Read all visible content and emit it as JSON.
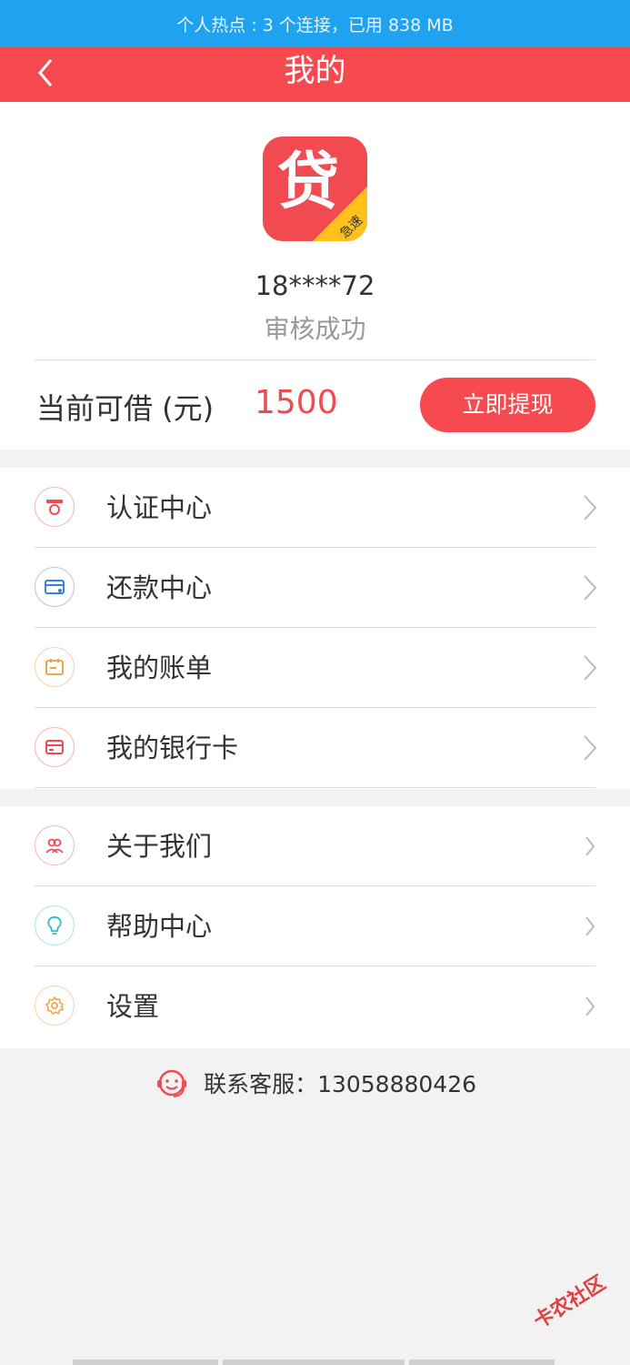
{
  "status_bar": {
    "text": "个人热点 : 3 个连接，已用 838 MB"
  },
  "header": {
    "title": "我的"
  },
  "profile": {
    "logo_char": "贷",
    "logo_badge": "急速",
    "phone": "18****72",
    "status": "审核成功",
    "borrow_label": "当前可借 (元)",
    "borrow_amount": "1500",
    "withdraw_button": "立即提现"
  },
  "menu_group_1": [
    {
      "label": "认证中心",
      "icon": "certification-icon",
      "color": "#f24a51"
    },
    {
      "label": "还款中心",
      "icon": "repayment-icon",
      "color": "#3b7fe0"
    },
    {
      "label": "我的账单",
      "icon": "bill-icon",
      "color": "#f5a24b"
    },
    {
      "label": "我的银行卡",
      "icon": "bank-card-icon",
      "color": "#f24a51"
    }
  ],
  "menu_group_2": [
    {
      "label": "关于我们",
      "icon": "about-us-icon",
      "color": "#f24a51"
    },
    {
      "label": "帮助中心",
      "icon": "help-icon",
      "color": "#2dbfbf"
    },
    {
      "label": "设置",
      "icon": "settings-icon",
      "color": "#f5a24b"
    }
  ],
  "contact": {
    "text": "联系客服：13058880426"
  },
  "watermark": {
    "text": "卡农社区"
  },
  "colors": {
    "accent": "#f64a51",
    "status_bar": "#1fa3f0"
  }
}
